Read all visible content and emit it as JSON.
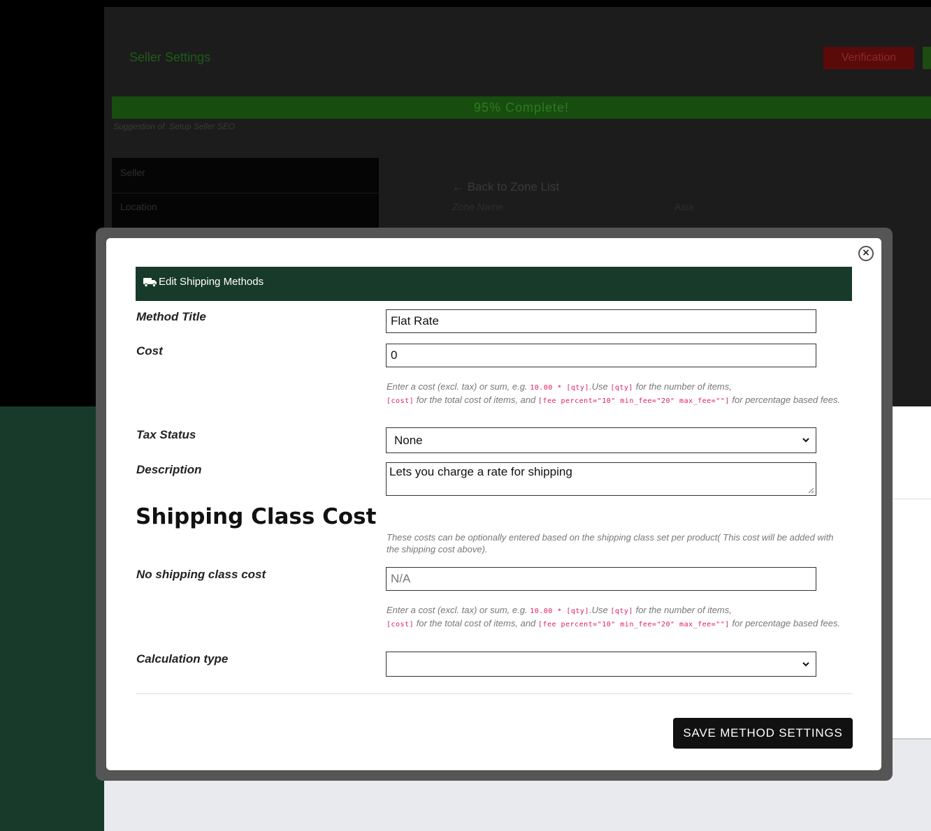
{
  "background": {
    "title": "Seller Settings",
    "verification_label": "Verification",
    "progress_text": "95% Complete!",
    "suggestion_text": "Suggestion of: Setup Seller SEO",
    "sidebar_items": [
      "Seller",
      "Location"
    ],
    "back_link": "← Back to Zone List",
    "zone_name_label": "Zone Name",
    "zone_name_value": "Asia"
  },
  "modal": {
    "close_icon": "×",
    "header_icon": "truck-icon",
    "header_title": "Edit Shipping Methods",
    "method_title": {
      "label": "Method Title",
      "value": "Flat Rate"
    },
    "cost": {
      "label": "Cost",
      "value": "0"
    },
    "cost_help": {
      "t1": "Enter a cost (excl. tax) or sum, e.g.",
      "c1": "10.00 * [qty]",
      "t2": ".Use",
      "c2": "[qty]",
      "t3": "for the number of items,",
      "c3": "[cost]",
      "t4": "for the total cost of items, and",
      "c4": "[fee percent=\"10\" min_fee=\"20\" max_fee=\"\"]",
      "t5": "for percentage based fees."
    },
    "tax_status": {
      "label": "Tax Status",
      "value": "None"
    },
    "description": {
      "label": "Description",
      "value": "Lets you charge a rate for shipping"
    },
    "shipping_class_title": "Shipping Class Cost",
    "shipping_class_help": "These costs can be optionally entered based on the shipping class set per product( This cost will be added with the shipping cost above).",
    "no_class_cost": {
      "label": "No shipping class cost",
      "placeholder": "N/A"
    },
    "no_class_help": {
      "t1": "Enter a cost (excl. tax) or sum, e.g.",
      "c1": "10.00 * [qty]",
      "t2": ".Use",
      "c2": "[qty]",
      "t3": "for the number of items,",
      "c3": "[cost]",
      "t4": "for the total cost of items, and",
      "c4": "[fee percent=\"10\" min_fee=\"20\" max_fee=\"\"]",
      "t5": "for percentage based fees."
    },
    "calculation_type": {
      "label": "Calculation type",
      "value": ""
    },
    "save_label": "SAVE METHOD SETTINGS"
  },
  "colors": {
    "header_bg": "#183a2a",
    "save_bg": "#111111",
    "code_color": "#e01e5a"
  }
}
